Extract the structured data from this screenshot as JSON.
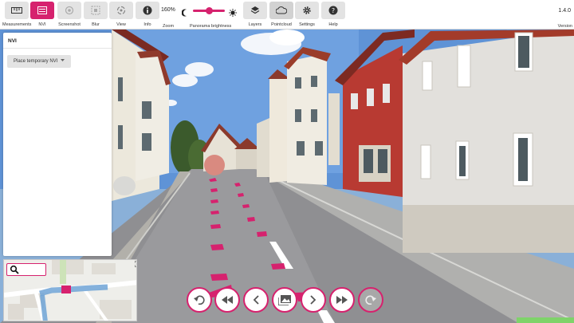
{
  "toolbar": {
    "tools": [
      {
        "key": "measurements",
        "label": "Measurements",
        "icon": "ruler-icon",
        "active": false
      },
      {
        "key": "nvi",
        "label": "NVI",
        "icon": "nvi-list-icon",
        "active": true
      },
      {
        "key": "screenshot",
        "label": "Screenshot",
        "icon": "screenshot-icon",
        "active": false
      },
      {
        "key": "blur",
        "label": "Blur",
        "icon": "blur-icon",
        "active": false
      },
      {
        "key": "view",
        "label": "View",
        "icon": "view-icon",
        "active": false
      },
      {
        "key": "info",
        "label": "Info",
        "icon": "info-icon",
        "active": false
      }
    ],
    "zoom": {
      "value": "160%",
      "label": "Zoom"
    },
    "panorama_brightness": {
      "label": "Panorama brightness",
      "level_fraction": 0.55
    },
    "tools_right": [
      {
        "key": "layers",
        "label": "Layers",
        "icon": "layers-icon"
      },
      {
        "key": "pointcloud",
        "label": "Pointcloud",
        "icon": "cloud-icon"
      },
      {
        "key": "settings",
        "label": "Settings",
        "icon": "gear-icon"
      },
      {
        "key": "help",
        "label": "Help",
        "icon": "help-icon"
      }
    ],
    "version": {
      "value": "1.4.0",
      "label": "Version"
    }
  },
  "panel": {
    "title": "NVI",
    "button_label": "Place temporary NVI"
  },
  "navigation": [
    {
      "key": "undo",
      "icon": "undo-icon"
    },
    {
      "key": "fast-back",
      "icon": "fast-back-icon"
    },
    {
      "key": "back",
      "icon": "chevron-left-icon"
    },
    {
      "key": "gallery",
      "icon": "image-gallery-icon"
    },
    {
      "key": "forward",
      "icon": "chevron-right-icon"
    },
    {
      "key": "fast-forward",
      "icon": "fast-forward-icon"
    },
    {
      "key": "redo",
      "icon": "redo-icon",
      "disabled": true
    }
  ],
  "colors": {
    "accent": "#d6226e",
    "toolbar_bg": "#ffffff",
    "button_bg": "#e3e3e3",
    "status_green": "#7fd36a"
  }
}
